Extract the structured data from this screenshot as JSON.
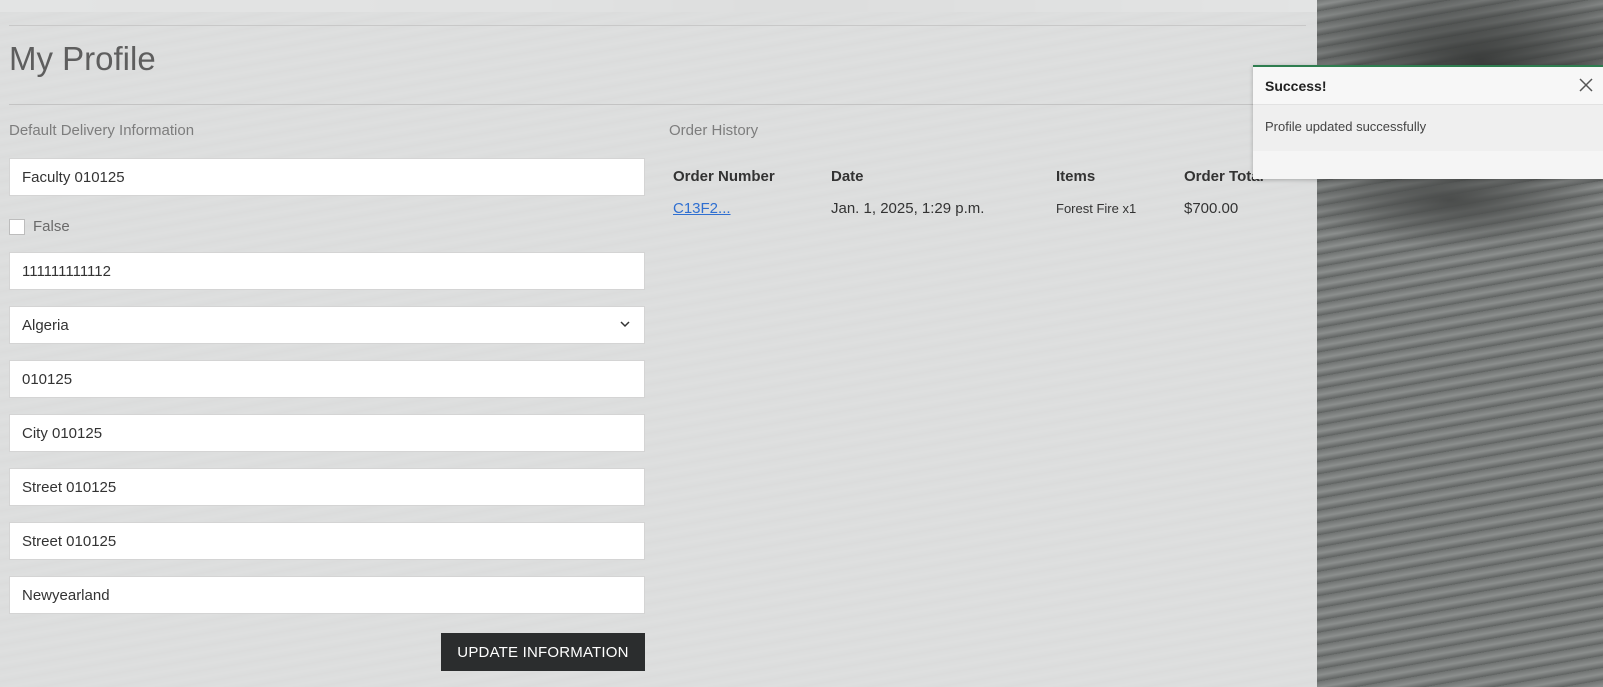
{
  "page": {
    "title": "My Profile"
  },
  "delivery": {
    "heading": "Default Delivery Information",
    "fields": {
      "name": "Faculty  010125",
      "checkbox_label": "False",
      "phone": "111111111112",
      "country": "Algeria",
      "postal": "010125",
      "city": "City 010125",
      "street1": "Street  010125",
      "street2": "Street  010125",
      "region": "Newyearland"
    },
    "submit_label": "UPDATE INFORMATION"
  },
  "orders": {
    "heading": "Order History",
    "columns": [
      "Order Number",
      "Date",
      "Items",
      "Order Total"
    ],
    "rows": [
      {
        "number": "C13F2...",
        "date": "Jan. 1, 2025, 1:29 p.m.",
        "items": "Forest Fire x1",
        "total": "$700.00"
      }
    ]
  },
  "toast": {
    "title": "Success!",
    "message": "Profile updated successfully",
    "accent": "#2e7d4f"
  },
  "icons": {
    "select": "chevron-down-icon",
    "close": "close-icon"
  }
}
